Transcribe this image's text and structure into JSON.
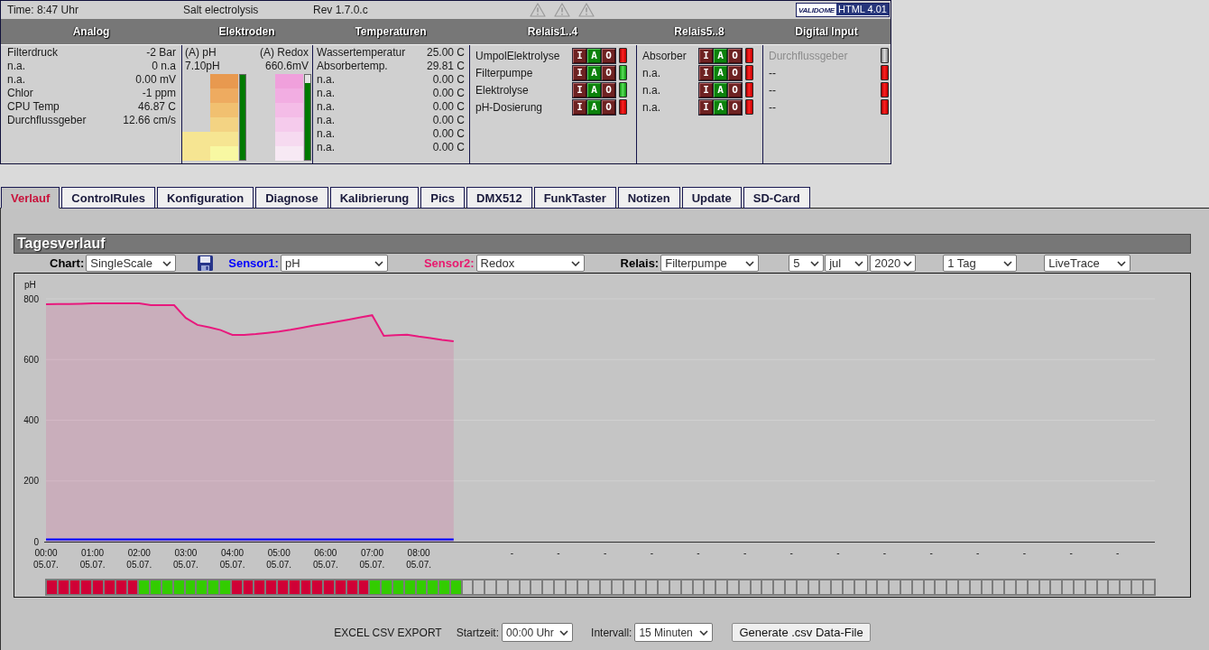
{
  "header": {
    "time": "Time: 8:47 Uhr",
    "title": "Salt electrolysis",
    "revision": "Rev 1.7.0.c",
    "validator": {
      "logo": "VALIDOME",
      "label": "HTML 4.01"
    }
  },
  "analog": {
    "title": "Analog",
    "rows": [
      {
        "label": "Filterdruck",
        "value": "-2 Bar"
      },
      {
        "label": "n.a.",
        "value": "0 n.a"
      },
      {
        "label": "n.a.",
        "value": "0.00 mV"
      },
      {
        "label": "Chlor",
        "value": "-1 ppm"
      },
      {
        "label": "CPU Temp",
        "value": "46.87 C"
      },
      {
        "label": "Durchflussgeber",
        "value": "12.66 cm/s"
      }
    ]
  },
  "electrodes": {
    "title": "Elektroden",
    "ph": {
      "label": "(A) pH",
      "value": "7.10pH",
      "level": 1.0
    },
    "redox": {
      "label": "(A) Redox",
      "value": "660.6mV",
      "level": 0.9
    }
  },
  "temperatures": {
    "title": "Temperaturen",
    "rows": [
      {
        "label": "Wassertemperatur",
        "value": "25.00 C"
      },
      {
        "label": "Absorbertemp.",
        "value": "29.81 C"
      },
      {
        "label": "n.a.",
        "value": "0.00 C"
      },
      {
        "label": "n.a.",
        "value": "0.00 C"
      },
      {
        "label": "n.a.",
        "value": "0.00 C"
      },
      {
        "label": "n.a.",
        "value": "0.00 C"
      },
      {
        "label": "n.a.",
        "value": "0.00 C"
      },
      {
        "label": "n.a.",
        "value": "0.00 C"
      }
    ]
  },
  "relays_1_4": {
    "title": "Relais1..4",
    "rows": [
      {
        "label": "UmpolElektrolyse",
        "modes": [
          {
            "label": "I",
            "selected": false
          },
          {
            "label": "A",
            "selected": true
          },
          {
            "label": "O",
            "selected": false
          }
        ],
        "on": false
      },
      {
        "label": "Filterpumpe",
        "modes": [
          {
            "label": "I",
            "selected": false
          },
          {
            "label": "A",
            "selected": true
          },
          {
            "label": "O",
            "selected": false
          }
        ],
        "on": true
      },
      {
        "label": "Elektrolyse",
        "modes": [
          {
            "label": "I",
            "selected": false
          },
          {
            "label": "A",
            "selected": true
          },
          {
            "label": "O",
            "selected": false
          }
        ],
        "on": true
      },
      {
        "label": "pH-Dosierung",
        "modes": [
          {
            "label": "I",
            "selected": false
          },
          {
            "label": "A",
            "selected": true
          },
          {
            "label": "O",
            "selected": false
          }
        ],
        "on": false
      }
    ]
  },
  "relays_5_8": {
    "title": "Relais5..8",
    "rows": [
      {
        "label": "Absorber",
        "modes": [
          {
            "label": "I",
            "selected": false
          },
          {
            "label": "A",
            "selected": true
          },
          {
            "label": "O",
            "selected": false
          }
        ],
        "on": false
      },
      {
        "label": "n.a.",
        "modes": [
          {
            "label": "I",
            "selected": false
          },
          {
            "label": "A",
            "selected": true
          },
          {
            "label": "O",
            "selected": false
          }
        ],
        "on": false
      },
      {
        "label": "n.a.",
        "modes": [
          {
            "label": "I",
            "selected": false
          },
          {
            "label": "A",
            "selected": true
          },
          {
            "label": "O",
            "selected": false
          }
        ],
        "on": false
      },
      {
        "label": "n.a.",
        "modes": [
          {
            "label": "I",
            "selected": false
          },
          {
            "label": "A",
            "selected": true
          },
          {
            "label": "O",
            "selected": false
          }
        ],
        "on": false
      }
    ]
  },
  "digital_input": {
    "title": "Digital Input",
    "rows": [
      {
        "label": "Durchflussgeber",
        "disabled": true
      },
      {
        "label": "--",
        "disabled": false,
        "on": false
      },
      {
        "label": "--",
        "disabled": false,
        "on": false
      },
      {
        "label": "--",
        "disabled": false,
        "on": false
      }
    ]
  },
  "tabs": [
    {
      "label": "Verlauf",
      "selected": true
    },
    {
      "label": "ControlRules",
      "selected": false
    },
    {
      "label": "Konfiguration",
      "selected": false
    },
    {
      "label": "Diagnose",
      "selected": false
    },
    {
      "label": "Kalibrierung",
      "selected": false
    },
    {
      "label": "Pics",
      "selected": false
    },
    {
      "label": "DMX512",
      "selected": false
    },
    {
      "label": "FunkTaster",
      "selected": false
    },
    {
      "label": "Notizen",
      "selected": false
    },
    {
      "label": "Update",
      "selected": false
    },
    {
      "label": "SD-Card",
      "selected": false
    }
  ],
  "chart_panel": {
    "title": "Tagesverlauf",
    "toolbar": [
      {
        "kind": "select",
        "label": "Chart:",
        "value": "SingleScale",
        "color": "#000000"
      },
      {
        "kind": "save"
      },
      {
        "kind": "select",
        "label": "Sensor1:",
        "value": "pH",
        "color": "#0000ff"
      },
      {
        "kind": "select",
        "label": "Sensor2:",
        "value": "Redox",
        "color": "#e8196e"
      },
      {
        "kind": "select",
        "label": "Relais:",
        "value": "Filterpumpe",
        "color": "#000000"
      },
      {
        "kind": "date",
        "day": "5",
        "month": "jul",
        "year": "2020"
      },
      {
        "kind": "select",
        "value": "1 Tag"
      },
      {
        "kind": "select",
        "value": "LiveTrace"
      }
    ],
    "chart_data": {
      "type": "area",
      "ylabel": "pH",
      "grid": true,
      "categories": [
        "00:00\n05.07.",
        null,
        null,
        null,
        "01:00\n05.07.",
        null,
        null,
        null,
        "02:00\n05.07.",
        null,
        null,
        null,
        "03:00\n05.07.",
        null,
        null,
        null,
        "04:00\n05.07.",
        null,
        null,
        null,
        "05:00\n05.07.",
        null,
        null,
        null,
        "06:00\n05.07.",
        null,
        null,
        null,
        "07:00\n05.07.",
        null,
        null,
        null,
        "08:00\n05.07.",
        null,
        null,
        null,
        null,
        null,
        null,
        null,
        "-",
        null,
        null,
        null,
        "-",
        null,
        null,
        null,
        "-",
        null,
        null,
        null,
        "-",
        null,
        null,
        null,
        "-",
        null,
        null,
        null,
        "-",
        null,
        null,
        null,
        "-",
        null,
        null,
        null,
        "-",
        null,
        null,
        null,
        "-",
        null,
        null,
        null,
        "-",
        null,
        null,
        null,
        "-",
        null,
        null,
        null,
        "-",
        null,
        null,
        null,
        "-",
        null,
        null,
        null,
        "-",
        null,
        null,
        null
      ],
      "series": [
        {
          "color": "#e8197d",
          "values": [
            782,
            783,
            783,
            784,
            785,
            785,
            785,
            785,
            785,
            779,
            779,
            779,
            737,
            714,
            706,
            697,
            681,
            681,
            684,
            688,
            692,
            698,
            705,
            712,
            718,
            725,
            732,
            739,
            746,
            678,
            680,
            682,
            676,
            671,
            665,
            660,
            null,
            null,
            null,
            null,
            null,
            null,
            null,
            null,
            null,
            null,
            null,
            null,
            null,
            null,
            null,
            null,
            null,
            null,
            null,
            null,
            null,
            null,
            null,
            null,
            null,
            null,
            null,
            null,
            null,
            null,
            null,
            null,
            null,
            null,
            null,
            null,
            null,
            null,
            null,
            null,
            null,
            null,
            null,
            null,
            null,
            null,
            null,
            null,
            null,
            null,
            null,
            null,
            null,
            null,
            null,
            null,
            null,
            null,
            null,
            null
          ]
        },
        {
          "color": "#0000ff",
          "values": [
            7,
            7,
            7,
            7,
            7,
            7,
            7,
            7,
            7,
            7,
            7,
            7,
            7,
            7,
            7,
            7,
            7,
            7,
            7,
            7,
            7,
            7,
            7,
            7,
            7,
            7,
            7,
            7,
            7,
            7,
            7,
            7,
            7,
            7,
            7,
            7,
            null,
            null,
            null,
            null,
            null,
            null,
            null,
            null,
            null,
            null,
            null,
            null,
            null,
            null,
            null,
            null,
            null,
            null,
            null,
            null,
            null,
            null,
            null,
            null,
            null,
            null,
            null,
            null,
            null,
            null,
            null,
            null,
            null,
            null,
            null,
            null,
            null,
            null,
            null,
            null,
            null,
            null,
            null,
            null,
            null,
            null,
            null,
            null,
            null,
            null,
            null,
            null,
            null,
            null,
            null,
            null,
            null,
            null,
            null,
            null
          ]
        }
      ],
      "ylim": [
        0,
        800
      ],
      "yticks": [
        0,
        200,
        400,
        600,
        800
      ]
    },
    "relay_timeline": [
      {
        "filled": true,
        "on": false
      },
      {
        "filled": true,
        "on": false
      },
      {
        "filled": true,
        "on": false
      },
      {
        "filled": true,
        "on": false
      },
      {
        "filled": true,
        "on": false
      },
      {
        "filled": true,
        "on": false
      },
      {
        "filled": true,
        "on": false
      },
      {
        "filled": true,
        "on": false
      },
      {
        "filled": true,
        "on": true
      },
      {
        "filled": true,
        "on": true
      },
      {
        "filled": true,
        "on": true
      },
      {
        "filled": true,
        "on": true
      },
      {
        "filled": true,
        "on": true
      },
      {
        "filled": true,
        "on": true
      },
      {
        "filled": true,
        "on": true
      },
      {
        "filled": true,
        "on": true
      },
      {
        "filled": true,
        "on": false
      },
      {
        "filled": true,
        "on": false
      },
      {
        "filled": true,
        "on": false
      },
      {
        "filled": true,
        "on": false
      },
      {
        "filled": true,
        "on": false
      },
      {
        "filled": true,
        "on": false
      },
      {
        "filled": true,
        "on": false
      },
      {
        "filled": true,
        "on": false
      },
      {
        "filled": true,
        "on": false
      },
      {
        "filled": true,
        "on": false
      },
      {
        "filled": true,
        "on": false
      },
      {
        "filled": true,
        "on": false
      },
      {
        "filled": true,
        "on": true
      },
      {
        "filled": true,
        "on": true
      },
      {
        "filled": true,
        "on": true
      },
      {
        "filled": true,
        "on": true
      },
      {
        "filled": true,
        "on": true
      },
      {
        "filled": true,
        "on": true
      },
      {
        "filled": true,
        "on": true
      },
      {
        "filled": true,
        "on": true
      },
      {
        "filled": false
      },
      {
        "filled": false
      },
      {
        "filled": false
      },
      {
        "filled": false
      },
      {
        "filled": false
      },
      {
        "filled": false
      },
      {
        "filled": false
      },
      {
        "filled": false
      },
      {
        "filled": false
      },
      {
        "filled": false
      },
      {
        "filled": false
      },
      {
        "filled": false
      },
      {
        "filled": false
      },
      {
        "filled": false
      },
      {
        "filled": false
      },
      {
        "filled": false
      },
      {
        "filled": false
      },
      {
        "filled": false
      },
      {
        "filled": false
      },
      {
        "filled": false
      },
      {
        "filled": false
      },
      {
        "filled": false
      },
      {
        "filled": false
      },
      {
        "filled": false
      },
      {
        "filled": false
      },
      {
        "filled": false
      },
      {
        "filled": false
      },
      {
        "filled": false
      },
      {
        "filled": false
      },
      {
        "filled": false
      },
      {
        "filled": false
      },
      {
        "filled": false
      },
      {
        "filled": false
      },
      {
        "filled": false
      },
      {
        "filled": false
      },
      {
        "filled": false
      },
      {
        "filled": false
      },
      {
        "filled": false
      },
      {
        "filled": false
      },
      {
        "filled": false
      },
      {
        "filled": false
      },
      {
        "filled": false
      },
      {
        "filled": false
      },
      {
        "filled": false
      },
      {
        "filled": false
      },
      {
        "filled": false
      },
      {
        "filled": false
      },
      {
        "filled": false
      },
      {
        "filled": false
      },
      {
        "filled": false
      },
      {
        "filled": false
      },
      {
        "filled": false
      },
      {
        "filled": false
      },
      {
        "filled": false
      },
      {
        "filled": false
      },
      {
        "filled": false
      },
      {
        "filled": false
      },
      {
        "filled": false
      },
      {
        "filled": false
      },
      {
        "filled": false
      }
    ]
  },
  "export": {
    "title": "EXCEL CSV EXPORT",
    "fields": [
      {
        "label": "Startzeit:",
        "value": "00:00 Uhr"
      },
      {
        "label": "Intervall:",
        "value": "15 Minuten"
      }
    ],
    "button": "Generate .csv Data-File"
  }
}
